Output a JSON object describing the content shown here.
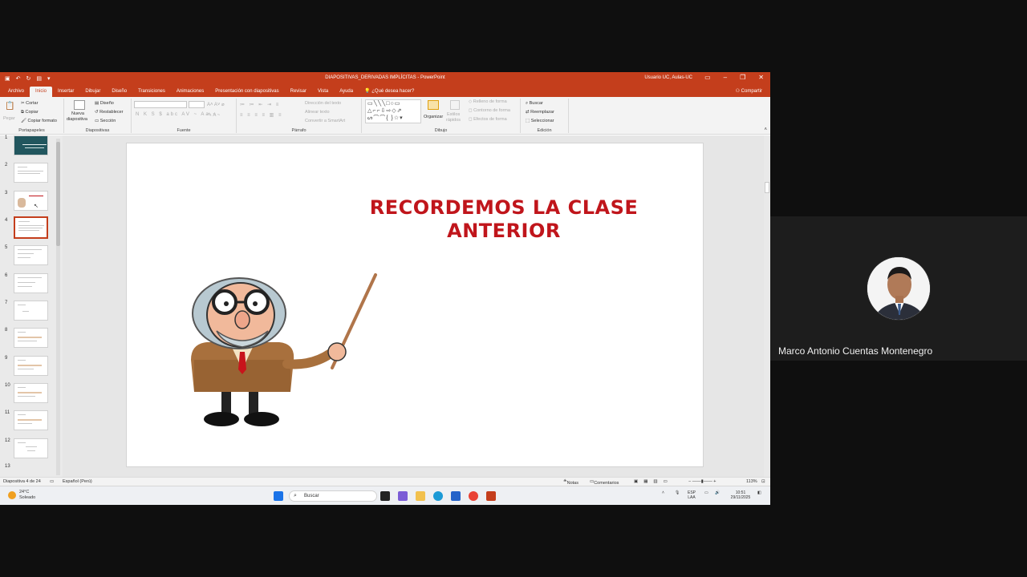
{
  "powerpoint": {
    "title": "DIAPOSITIVAS_DERIVADAS IMPLÍCITAS  -  PowerPoint",
    "user": "Usuario UC, Aulas-UC",
    "tabs": [
      "Archivo",
      "Inicio",
      "Insertar",
      "Dibujar",
      "Diseño",
      "Transiciones",
      "Animaciones",
      "Presentación con diapositivas",
      "Revisar",
      "Vista",
      "Ayuda",
      "¿Qué desea hacer?"
    ],
    "active_tab": "Inicio",
    "share": "Compartir",
    "ribbon": {
      "clipboard": {
        "paste": "Pegar",
        "cut": "Cortar",
        "copy": "Copiar",
        "format_painter": "Copiar formato",
        "group": "Portapapeles"
      },
      "slides": {
        "new_slide_1": "Nueva",
        "new_slide_2": "diapositiva",
        "layout": "Diseño",
        "reset": "Restablecer",
        "section": "Sección",
        "group": "Diapositivas"
      },
      "font": {
        "group": "Fuente"
      },
      "paragraph": {
        "text_direction": "Dirección del texto",
        "align_text": "Alinear texto",
        "smartart": "Convertir a SmartArt",
        "group": "Párrafo"
      },
      "drawing": {
        "arrange": "Organizar",
        "quick_styles_1": "Estilos",
        "quick_styles_2": "rápidos",
        "shape_fill": "Relleno de forma",
        "shape_outline": "Contorno de forma",
        "shape_effects": "Efectos de forma",
        "group": "Dibujo"
      },
      "editing": {
        "find": "Buscar",
        "replace": "Reemplazar",
        "select": "Seleccionar",
        "group": "Edición"
      }
    },
    "thumbnails": [
      "1",
      "2",
      "3",
      "4",
      "5",
      "6",
      "7",
      "8",
      "9",
      "10",
      "11",
      "12",
      "13"
    ],
    "selected_slide": "4",
    "slide": {
      "title_line1": "RECORDEMOS LA CLASE",
      "title_line2": "ANTERIOR"
    },
    "status": {
      "slide_count": "Diapositiva 4 de 24",
      "language": "Español (Perú)",
      "notes": "Notas",
      "comments": "Comentarios",
      "zoom": "113%"
    },
    "taskbar": {
      "temp": "24°C",
      "weather": "Soleado",
      "search": "Buscar",
      "lang1": "ESP",
      "lang2": "LAA",
      "time": "10:51",
      "date": "29/11/2025"
    }
  },
  "participant": {
    "name": "Marco Antonio Cuentas Montenegro"
  },
  "colors": {
    "ppt_accent": "#c43e1c",
    "title_red": "#c0151b"
  }
}
